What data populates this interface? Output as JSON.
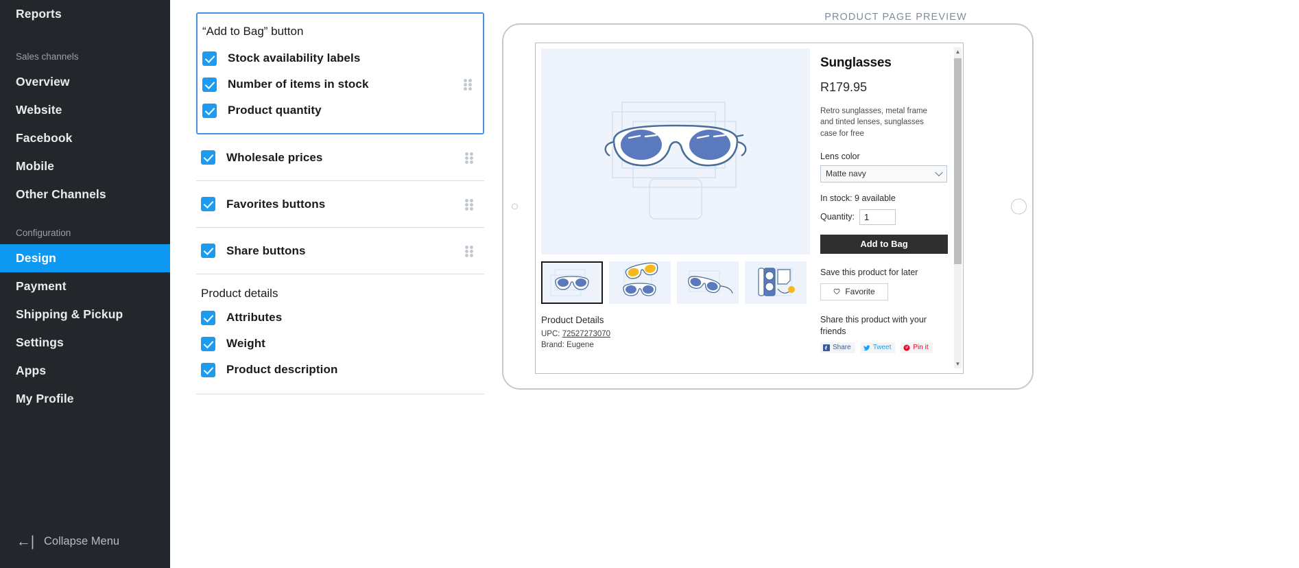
{
  "sidebar": {
    "top_item": "Reports",
    "sections": [
      {
        "label": "Sales channels",
        "items": [
          "Overview",
          "Website",
          "Facebook",
          "Mobile",
          "Other Channels"
        ]
      },
      {
        "label": "Configuration",
        "items": [
          "Design",
          "Payment",
          "Shipping & Pickup",
          "Settings",
          "Apps",
          "My Profile"
        ]
      }
    ],
    "active_item": "Design",
    "collapse_label": "Collapse Menu",
    "collapse_icon": "arrow-left-bar-icon",
    "accent_color": "#0d99f2",
    "background_color": "#23272b"
  },
  "settings": {
    "group": {
      "title": "“Add to Bag” button",
      "highlight_color": "#4a90e2",
      "options": [
        {
          "label": "Stock availability labels",
          "checked": true
        },
        {
          "label": "Number of items in stock",
          "checked": true
        },
        {
          "label": "Product quantity",
          "checked": true
        }
      ]
    },
    "rows": [
      {
        "label": "Wholesale prices",
        "checked": true
      },
      {
        "label": "Favorites buttons",
        "checked": true
      },
      {
        "label": "Share buttons",
        "checked": true
      }
    ],
    "product_details": {
      "heading": "Product details",
      "options": [
        {
          "label": "Attributes",
          "checked": true
        },
        {
          "label": "Weight",
          "checked": true
        },
        {
          "label": "Product description",
          "checked": true
        }
      ]
    },
    "drag_handle_icon": "drag-handle-icon",
    "checkbox_color": "#1d9bf0"
  },
  "preview": {
    "title": "PRODUCT PAGE PREVIEW",
    "product": {
      "name": "Sunglasses",
      "price": "R179.95",
      "description": "Retro sunglasses, metal frame and tinted lenses, sunglasses case for free",
      "lens_color_label": "Lens color",
      "lens_color_value": "Matte navy",
      "stock_text": "In stock: 9 available",
      "quantity_label": "Quantity:",
      "quantity_value": "1",
      "add_to_bag_label": "Add to Bag",
      "save_text": "Save this product for later",
      "favorite_label": "Favorite",
      "favorite_icon": "heart-icon",
      "share_text": "Share this product with your friends",
      "share_buttons": [
        {
          "label": "Share",
          "icon": "facebook-icon",
          "color": "#3b5998"
        },
        {
          "label": "Tweet",
          "icon": "twitter-icon",
          "color": "#1da1f2"
        },
        {
          "label": "Pin it",
          "icon": "pinterest-icon",
          "color": "#e60023"
        }
      ],
      "details_heading": "Product Details",
      "upc_label": "UPC:",
      "upc_value": "72527273070",
      "brand_line": "Brand: Eugene"
    },
    "thumbnails": [
      {
        "name": "front-view-thumbnail",
        "selected": true
      },
      {
        "name": "pair-stacked-thumbnail",
        "selected": false
      },
      {
        "name": "angled-view-thumbnail",
        "selected": false
      },
      {
        "name": "case-thumbnail",
        "selected": false
      }
    ]
  }
}
